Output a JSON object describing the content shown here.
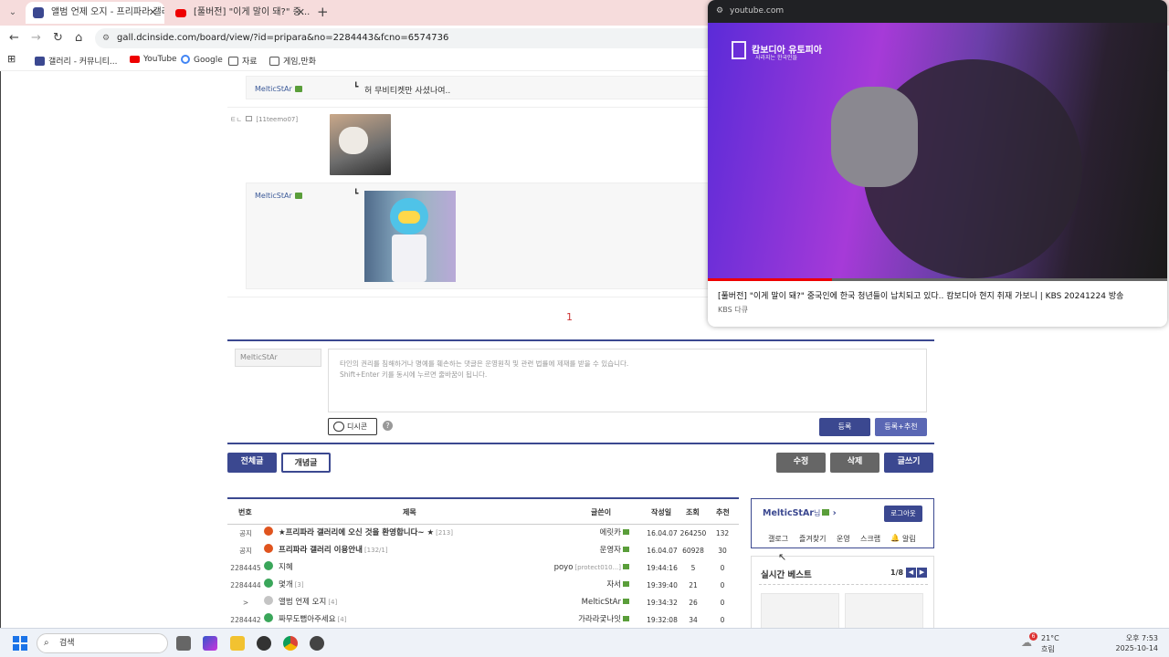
{
  "browser": {
    "tabs": [
      {
        "title": "앨범 언제 오지 - 프리파라 갤러..."
      },
      {
        "title": "[풀버전] \"이게 말이 돼?\" 중..."
      }
    ],
    "url": "gall.dcinside.com/board/view/?id=pripara&no=2284443&fcno=6574736",
    "bookmarks": [
      "갤러리 - 커뮤니티...",
      "YouTube",
      "Google",
      "자료",
      "게임,만화"
    ]
  },
  "comments": {
    "c1": {
      "nick": "MelticStAr",
      "text": "허 무비티켓만 사셨나여.."
    },
    "c2": {
      "prefix": "ㅌㄴ",
      "id": "[11teemo07]"
    },
    "c3": {
      "nick": "MelticStAr"
    }
  },
  "pagination": {
    "current": "1"
  },
  "comment_form": {
    "name": "MelticStAr",
    "notice1": "타인의 권리를 침해하거나 명예를 훼손하는 댓글은 운영원칙 및 관련 법률에 제재를 받을 수 있습니다.",
    "notice2": "Shift+Enter 키를 동시에 누르면 줄바꿈이 됩니다.",
    "dccon": "디시콘",
    "help": "?",
    "submit": "등록",
    "submit_rec": "등록+추천"
  },
  "actions": {
    "all": "전체글",
    "concept": "개념글",
    "edit": "수정",
    "delete": "삭제",
    "write": "글쓰기"
  },
  "table": {
    "headers": [
      "번호",
      "제목",
      "글쓴이",
      "작성일",
      "조회",
      "추천"
    ],
    "rows": [
      {
        "no": "공지",
        "title": "★프리파라 갤러리에 오신 것을 환영합니다~ ★",
        "cnt": "[213]",
        "author": "에릿카",
        "date": "16.04.07",
        "views": "264250",
        "rec": "132",
        "bold": true,
        "icon": "notice"
      },
      {
        "no": "공지",
        "title": "프리파라 갤러리 이용안내",
        "cnt": "[132/1]",
        "author": "운영자",
        "date": "16.04.07",
        "views": "60928",
        "rec": "30",
        "bold": true,
        "icon": "notice"
      },
      {
        "no": "2284445",
        "title": "지혜",
        "cnt": "",
        "author": "poyo",
        "sub": "[protect010...]",
        "date": "19:44:16",
        "views": "5",
        "rec": "0",
        "icon": "post"
      },
      {
        "no": "2284444",
        "title": "몇개",
        "cnt": "[3]",
        "author": "자서",
        "date": "19:39:40",
        "views": "21",
        "rec": "0",
        "icon": "post"
      },
      {
        "no": ">",
        "title": "앨범 언제 오지",
        "cnt": "[4]",
        "author": "MelticStAr",
        "date": "19:34:32",
        "views": "26",
        "rec": "0",
        "icon": "current"
      },
      {
        "no": "2284442",
        "title": "짜무도뻠아주세요",
        "cnt": "[4]",
        "author": "가라라궃나잇",
        "date": "19:32:08",
        "views": "34",
        "rec": "0",
        "icon": "post"
      }
    ]
  },
  "user_box": {
    "name": "MelticStAr",
    "suffix": "님",
    "logout": "로그아웃",
    "links": [
      "갤로그",
      "즐겨찾기",
      "운영",
      "스크랩",
      "알림"
    ]
  },
  "best": {
    "title": "실시간 베스트",
    "page": "1/8"
  },
  "pip": {
    "domain": "youtube.com",
    "channel_logo": "캄보디아 유토피아",
    "logo_sub": "사라지는 한국인들",
    "title": "[풀버전] \"이게 말이 돼?\" 중국인에 한국 청년들이 납치되고 있다.. 캄보디아 현지 취재 가보니 | KBS 20241224 방송",
    "channel": "KBS 다큐",
    "progress": 0.27
  },
  "taskbar": {
    "search": "검색",
    "weather_temp": "21°C",
    "weather_desc": "흐림",
    "weather_badge": "6",
    "time": "오후 7:53",
    "date": "2025-10-14"
  },
  "colors": {
    "navy": "#3b4890",
    "tab_bg": "#f6dcdc",
    "gray_btn": "#666666"
  }
}
